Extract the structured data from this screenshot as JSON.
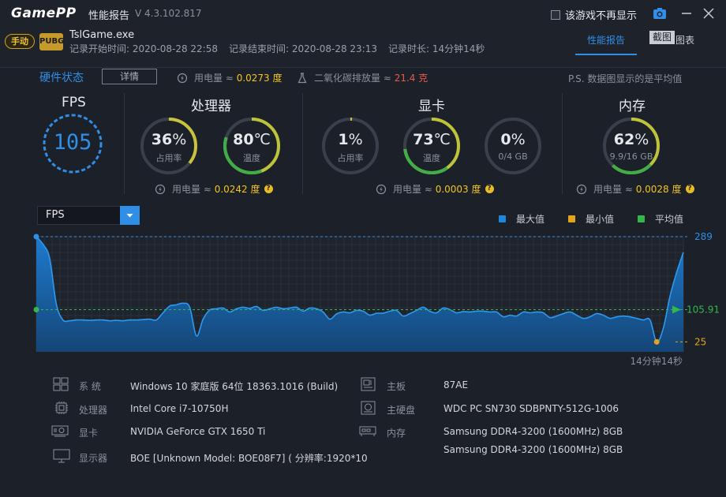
{
  "app": {
    "logo": "GamePP",
    "title": "性能报告",
    "version": "V 4.3.102.817",
    "no_more_label": "该游戏不再显示"
  },
  "session": {
    "mode_badge": "手动",
    "game_icon_text": "PUBG",
    "game_name": "TslGame.exe",
    "start_time": "记录开始时间: 2020-08-28 22:58",
    "end_time": "记录结束时间: 2020-08-28 23:13",
    "duration": "记录时长: 14分钟14秒"
  },
  "tabs": {
    "report": "性能报告",
    "screenshot": "截图",
    "chart": "图表"
  },
  "hardware": {
    "title": "硬件状态",
    "detail_button": "详情",
    "total_power_prefix": "用电量 ≈",
    "total_power_value": "0.0273 度",
    "co2_prefix": "二氧化碳排放量 ≈",
    "co2_value": "21.4 克",
    "note": "P.S. 数据图显示的是平均值"
  },
  "fps": {
    "label": "FPS",
    "value": "105"
  },
  "cpu": {
    "title": "处理器",
    "usage": 36,
    "usage_text": "36",
    "usage_unit": "%",
    "usage_label": "占用率",
    "temp": 80,
    "temp_text": "80",
    "temp_unit": "℃",
    "temp_label": "温度",
    "power_prefix": "用电量 ≈",
    "power_value": "0.0242 度"
  },
  "gpu": {
    "title": "显卡",
    "usage": 1,
    "usage_text": "1",
    "usage_unit": "%",
    "usage_label": "占用率",
    "temp": 73,
    "temp_text": "73",
    "temp_unit": "℃",
    "temp_label": "温度",
    "vram": 0,
    "vram_text": "0",
    "vram_unit": "%",
    "vram_label": "0/4 GB",
    "power_prefix": "用电量 ≈",
    "power_value": "0.0003 度"
  },
  "memory": {
    "title": "内存",
    "usage": 62,
    "usage_text": "62",
    "usage_unit": "%",
    "usage_label": "9.9/16 GB",
    "power_prefix": "用电量 ≈",
    "power_value": "0.0028 度"
  },
  "chart": {
    "metric_select": "FPS",
    "legend_max": "最大值",
    "legend_min": "最小值",
    "legend_avg": "平均值",
    "max_label": "289",
    "avg_label": "105.91",
    "min_label": "25",
    "duration_label": "14分钟14秒",
    "colors": {
      "max": "#1f86de",
      "min": "#e3a41c",
      "avg": "#35b54a"
    }
  },
  "chart_data": {
    "type": "area",
    "title": "",
    "xlabel": "",
    "ylabel": "",
    "ylim": [
      0,
      289
    ],
    "max": 289,
    "min": 25,
    "avg": 105.91,
    "series": [
      {
        "values": [
          289,
          270,
          235,
          120,
          80,
          78,
          80,
          80,
          79,
          80,
          80,
          78,
          79,
          78,
          80,
          80,
          81,
          82,
          80,
          98,
          115,
          118,
          122,
          112,
          40,
          82,
          105,
          108,
          110,
          100,
          108,
          112,
          109,
          114,
          104,
          108,
          112,
          108,
          110,
          112,
          102,
          110,
          108,
          100,
          82,
          95,
          100,
          98,
          104,
          102,
          92,
          97,
          97,
          102,
          104,
          90,
          96,
          104,
          112,
          102,
          98,
          110,
          106,
          98,
          101,
          100,
          102,
          102,
          100,
          100,
          88,
          92,
          90,
          100,
          98,
          100,
          98,
          86,
          90,
          96,
          100,
          92,
          84,
          88,
          96,
          92,
          84,
          88,
          90,
          88,
          84,
          80,
          80,
          25,
          60,
          140,
          200,
          250
        ]
      }
    ]
  },
  "sysinfo": {
    "os_label": "系  统",
    "os_value": "Windows 10 家庭版 64位   18363.1016 (Build)",
    "cpu_label": "处理器",
    "cpu_value": "Intel Core i7-10750H",
    "gpu_label": "显卡",
    "gpu_value": "NVIDIA GeForce GTX 1650 Ti",
    "monitor_label": "显示器",
    "monitor_value": "BOE [Unknown Model: BOE08F7] ( 分辨率:1920*10",
    "board_label": "主板",
    "board_value": "87AE",
    "disk_label": "主硬盘",
    "disk_value": "WDC PC SN730 SDBPNTY-512G-1006",
    "ram_label": "内存",
    "ram_value_1": "Samsung DDR4-3200 (1600MHz) 8GB",
    "ram_value_2": "Samsung DDR4-3200 (1600MHz) 8GB"
  }
}
